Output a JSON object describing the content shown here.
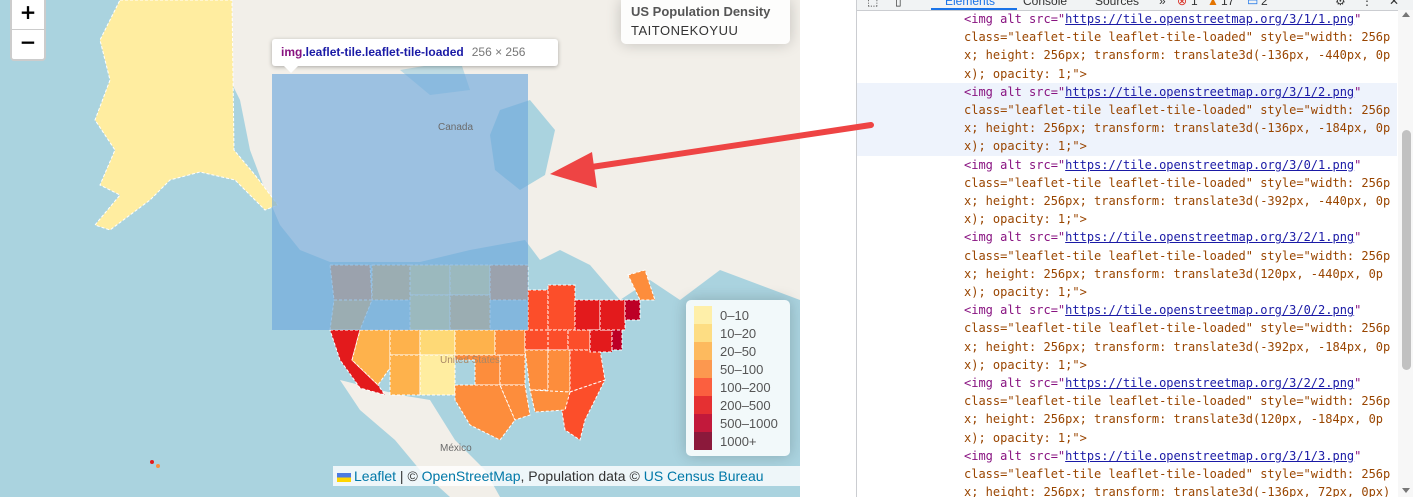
{
  "map": {
    "zoom_in_label": "+",
    "zoom_out_label": "−",
    "info": {
      "title": "US Population Density",
      "subtitle": "TAITONEKOYUU"
    },
    "tooltip": {
      "tag": "img",
      "classes": ".leaflet-tile.leaflet-tile-loaded",
      "size": "256 × 256"
    },
    "labels": {
      "canada": "Canada",
      "us": "United States",
      "mexico": "México"
    },
    "legend": [
      {
        "label": "0–10",
        "color": "#FFEDA0"
      },
      {
        "label": "10–20",
        "color": "#FED976"
      },
      {
        "label": "20–50",
        "color": "#FEB24C"
      },
      {
        "label": "50–100",
        "color": "#FD8D3C"
      },
      {
        "label": "100–200",
        "color": "#FC4E2A"
      },
      {
        "label": "200–500",
        "color": "#E31A1C"
      },
      {
        "label": "500–1000",
        "color": "#BD0026"
      },
      {
        "label": "1000+",
        "color": "#800026"
      }
    ],
    "attribution": {
      "leaflet": "Leaflet",
      "sep": " | © ",
      "osm": "OpenStreetMap",
      "pop": ", Population data © ",
      "census": "US Census Bureau"
    },
    "colors": {
      "water": "#aad3df",
      "land": "#f2efe9",
      "alaska": "#FFEDA0",
      "highlight": "#6fa8dc"
    }
  },
  "devtools": {
    "tabs": [
      "Elements",
      "Console",
      "Sources",
      "»"
    ],
    "badges": {
      "errors": "1",
      "warnings": "17",
      "messages": "2"
    },
    "lines": [
      {
        "pre": "<img alt src=\"",
        "url": "https://tile.openstreetmap.org/3/1/1.png",
        "post": "\""
      },
      {
        "text": "class=\"leaflet-tile leaflet-tile-loaded\" style=\"width: 256p"
      },
      {
        "text": "x; height: 256px; transform: translate3d(-136px, -440px, 0p"
      },
      {
        "text": "x); opacity: 1;\">"
      },
      {
        "pre": "<img alt src=\"",
        "url": "https://tile.openstreetmap.org/3/1/2.png",
        "post": "\"",
        "selected": true
      },
      {
        "text": "class=\"leaflet-tile leaflet-tile-loaded\" style=\"width: 256p",
        "selected": true
      },
      {
        "text": "x; height: 256px; transform: translate3d(-136px, -184px, 0p",
        "selected": true
      },
      {
        "text": "x); opacity: 1;\">",
        "selected": true
      },
      {
        "pre": "<img alt src=\"",
        "url": "https://tile.openstreetmap.org/3/0/1.png",
        "post": "\""
      },
      {
        "text": "class=\"leaflet-tile leaflet-tile-loaded\" style=\"width: 256p"
      },
      {
        "text": "x; height: 256px; transform: translate3d(-392px, -440px, 0p"
      },
      {
        "text": "x); opacity: 1;\">"
      },
      {
        "pre": "<img alt src=\"",
        "url": "https://tile.openstreetmap.org/3/2/1.png",
        "post": "\""
      },
      {
        "text": "class=\"leaflet-tile leaflet-tile-loaded\" style=\"width: 256p"
      },
      {
        "text": "x; height: 256px; transform: translate3d(120px, -440px, 0p"
      },
      {
        "text": "x); opacity: 1;\">"
      },
      {
        "pre": "<img alt src=\"",
        "url": "https://tile.openstreetmap.org/3/0/2.png",
        "post": "\""
      },
      {
        "text": "class=\"leaflet-tile leaflet-tile-loaded\" style=\"width: 256p"
      },
      {
        "text": "x; height: 256px; transform: translate3d(-392px, -184px, 0p"
      },
      {
        "text": "x); opacity: 1;\">"
      },
      {
        "pre": "<img alt src=\"",
        "url": "https://tile.openstreetmap.org/3/2/2.png",
        "post": "\""
      },
      {
        "text": "class=\"leaflet-tile leaflet-tile-loaded\" style=\"width: 256p"
      },
      {
        "text": "x; height: 256px; transform: translate3d(120px, -184px, 0p"
      },
      {
        "text": "x); opacity: 1;\">"
      },
      {
        "pre": "<img alt src=\"",
        "url": "https://tile.openstreetmap.org/3/1/3.png",
        "post": "\""
      },
      {
        "text": "class=\"leaflet-tile leaflet-tile-loaded\" style=\"width: 256p"
      },
      {
        "text": "x; height: 256px; transform: translate3d(-136px, 72px, 0px)"
      }
    ]
  }
}
